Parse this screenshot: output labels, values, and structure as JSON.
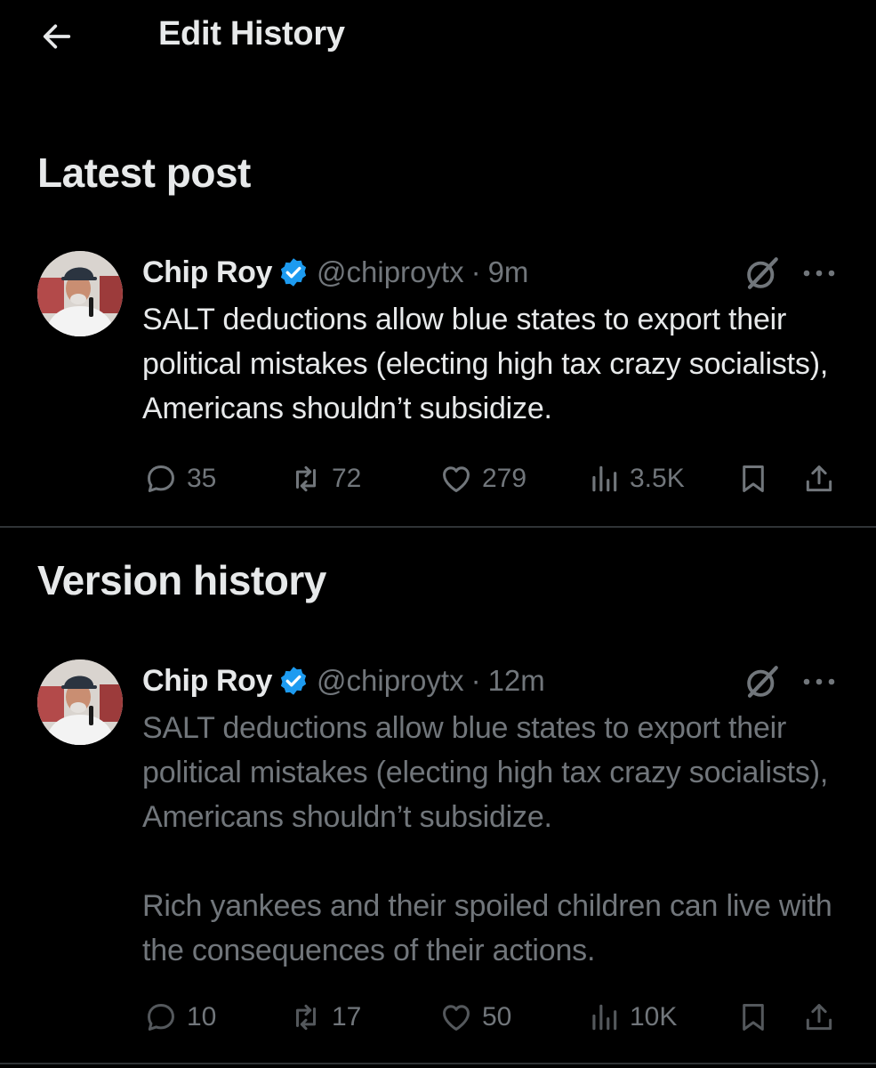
{
  "header": {
    "title": "Edit History"
  },
  "sections": {
    "latest": "Latest post",
    "history": "Version history"
  },
  "latest_post": {
    "name": "Chip Roy",
    "handle": "@chiproytx",
    "dot": "·",
    "time": "9m",
    "paragraphs": [
      "SALT deductions allow blue states to export their political mistakes (electing high tax crazy socialists), Americans shouldn’t subsidize."
    ],
    "replies": "35",
    "reposts": "72",
    "likes": "279",
    "views": "3.5K"
  },
  "previous_version": {
    "name": "Chip Roy",
    "handle": "@chiproytx",
    "dot": "·",
    "time": "12m",
    "paragraphs": [
      "SALT deductions allow blue states to export their political mistakes (electing high tax crazy socialists), Americans shouldn’t subsidize.",
      "Rich yankees and their spoiled children can live with the consequences of their actions."
    ],
    "replies": "10",
    "reposts": "17",
    "likes": "50",
    "views": "10K"
  },
  "colors": {
    "background": "#000000",
    "text": "#e7e9ea",
    "muted": "#71767b",
    "verified": "#1d9bf0",
    "divider": "#2f3336"
  },
  "icons": [
    "back-arrow-icon",
    "verified-badge-icon",
    "grok-icon",
    "more-icon",
    "reply-icon",
    "repost-icon",
    "like-icon",
    "views-icon",
    "bookmark-icon",
    "share-icon"
  ]
}
